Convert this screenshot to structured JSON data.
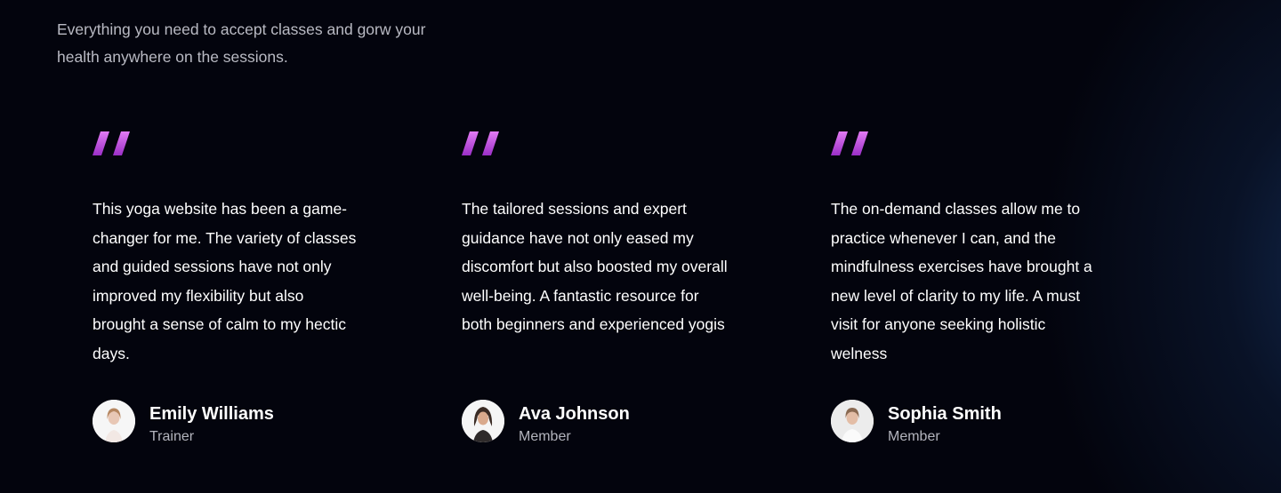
{
  "intro": {
    "text": "Everything you need to accept classes and gorw your health anywhere on the sessions."
  },
  "colors": {
    "background": "#03040d",
    "accent_gradient_start": "#e27bf3",
    "accent_gradient_end": "#9b2fc7",
    "muted_text": "#b9bac3"
  },
  "testimonials": [
    {
      "quote_icon": "quote-icon",
      "text": "This yoga website has been a game-changer for me. The variety of classes and guided sessions have not only improved my flexibility but also brought a sense of calm to my hectic days.",
      "name": "Emily Williams",
      "role": "Trainer",
      "avatar": "avatar-emily-williams"
    },
    {
      "quote_icon": "quote-icon",
      "text": "The tailored sessions and expert guidance have not only eased my discomfort but also boosted my overall well-being. A fantastic resource for both beginners and experienced yogis",
      "name": "Ava Johnson",
      "role": "Member",
      "avatar": "avatar-ava-johnson"
    },
    {
      "quote_icon": "quote-icon",
      "text": "The on-demand classes allow me to practice whenever I can, and the mindfulness exercises have brought a new level of clarity to my life. A must visit for anyone seeking holistic welness",
      "name": "Sophia Smith",
      "role": "Member",
      "avatar": "avatar-sophia-smith"
    }
  ]
}
